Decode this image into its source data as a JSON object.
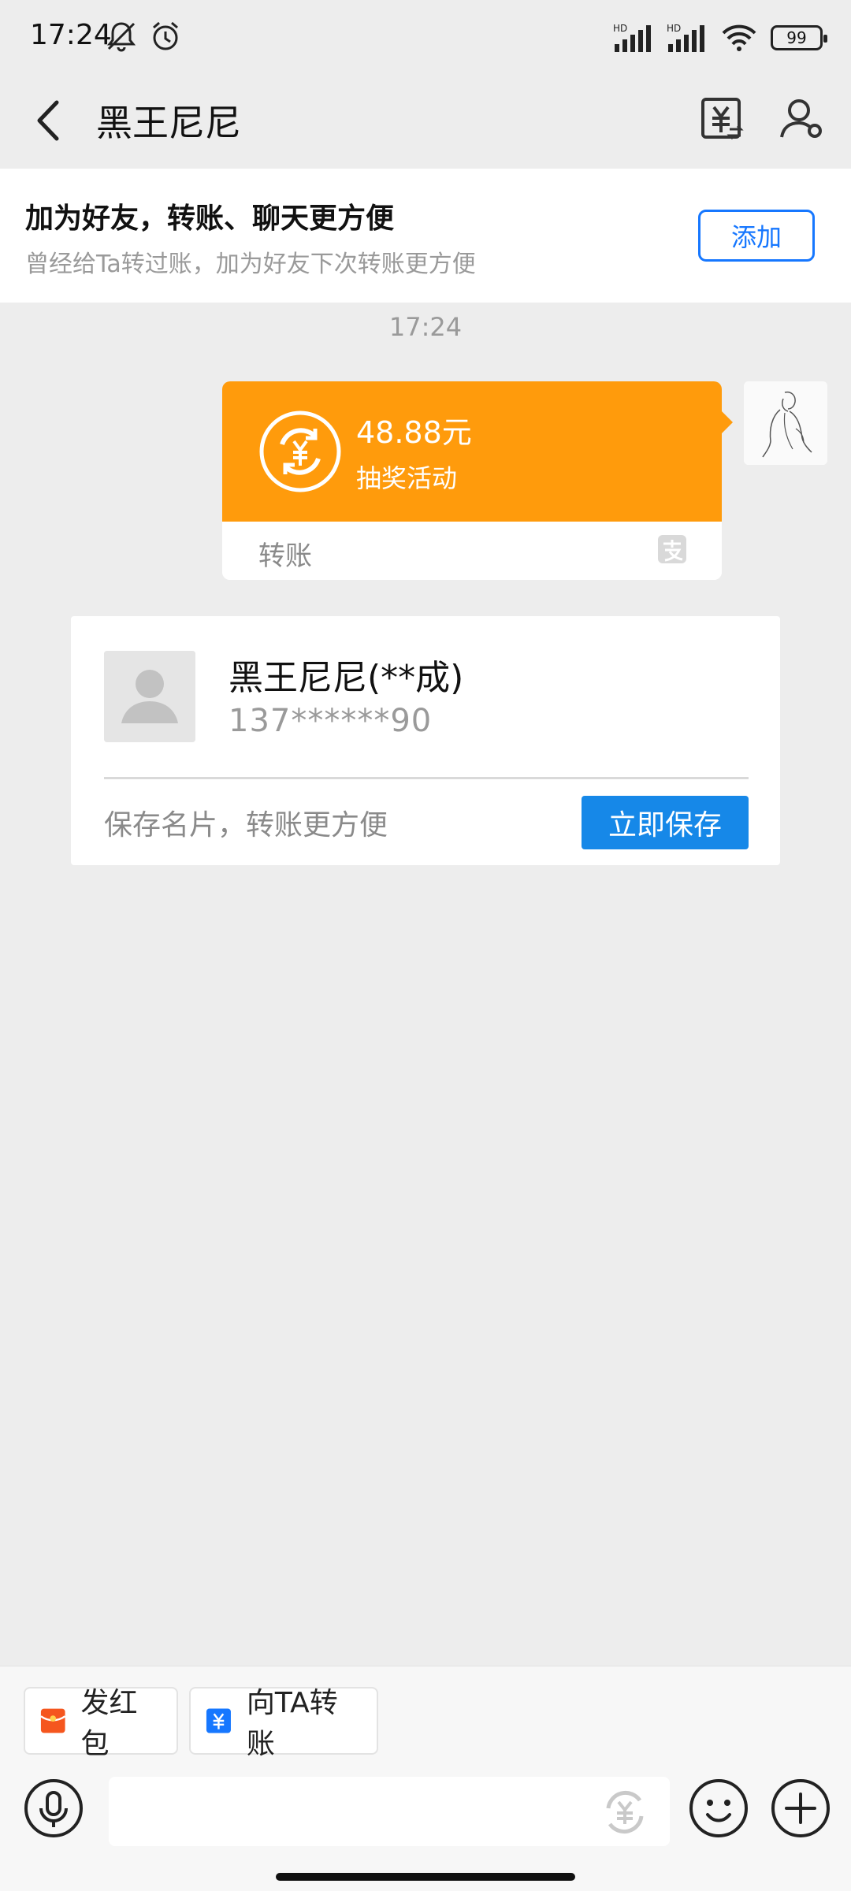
{
  "status_bar": {
    "time": "17:24",
    "network_label": "HD",
    "battery": "99"
  },
  "header": {
    "title": "黑王尼尼"
  },
  "friend_banner": {
    "title": "加为好友，转账、聊天更方便",
    "subtitle": "曾经给Ta转过账，加为好友下次转账更方便",
    "add_label": "添加"
  },
  "chat": {
    "time": "17:24",
    "transfer": {
      "amount": "48.88元",
      "description": "抽奖活动",
      "label": "转账"
    },
    "contact_card": {
      "name": "黑王尼尼(**成)",
      "phone": "137******90",
      "hint": "保存名片，转账更方便",
      "save_label": "立即保存"
    }
  },
  "bottom": {
    "red_packet_label": "发红包",
    "transfer_label": "向TA转账"
  },
  "colors": {
    "accent_blue": "#1677ff",
    "transfer_orange": "#ff9b0c",
    "save_blue": "#1688e8",
    "red_packet": "#f5561e"
  },
  "icons": [
    "back-icon",
    "transfer-yuan-icon",
    "profile-settings-icon",
    "coin-transfer-icon",
    "alipay-icon",
    "red-packet-icon",
    "yuan-transfer-icon",
    "voice-icon",
    "yuan-input-icon",
    "emoji-icon",
    "plus-icon",
    "silent-bell-icon",
    "alarm-icon",
    "signal-icon",
    "wifi-icon"
  ]
}
